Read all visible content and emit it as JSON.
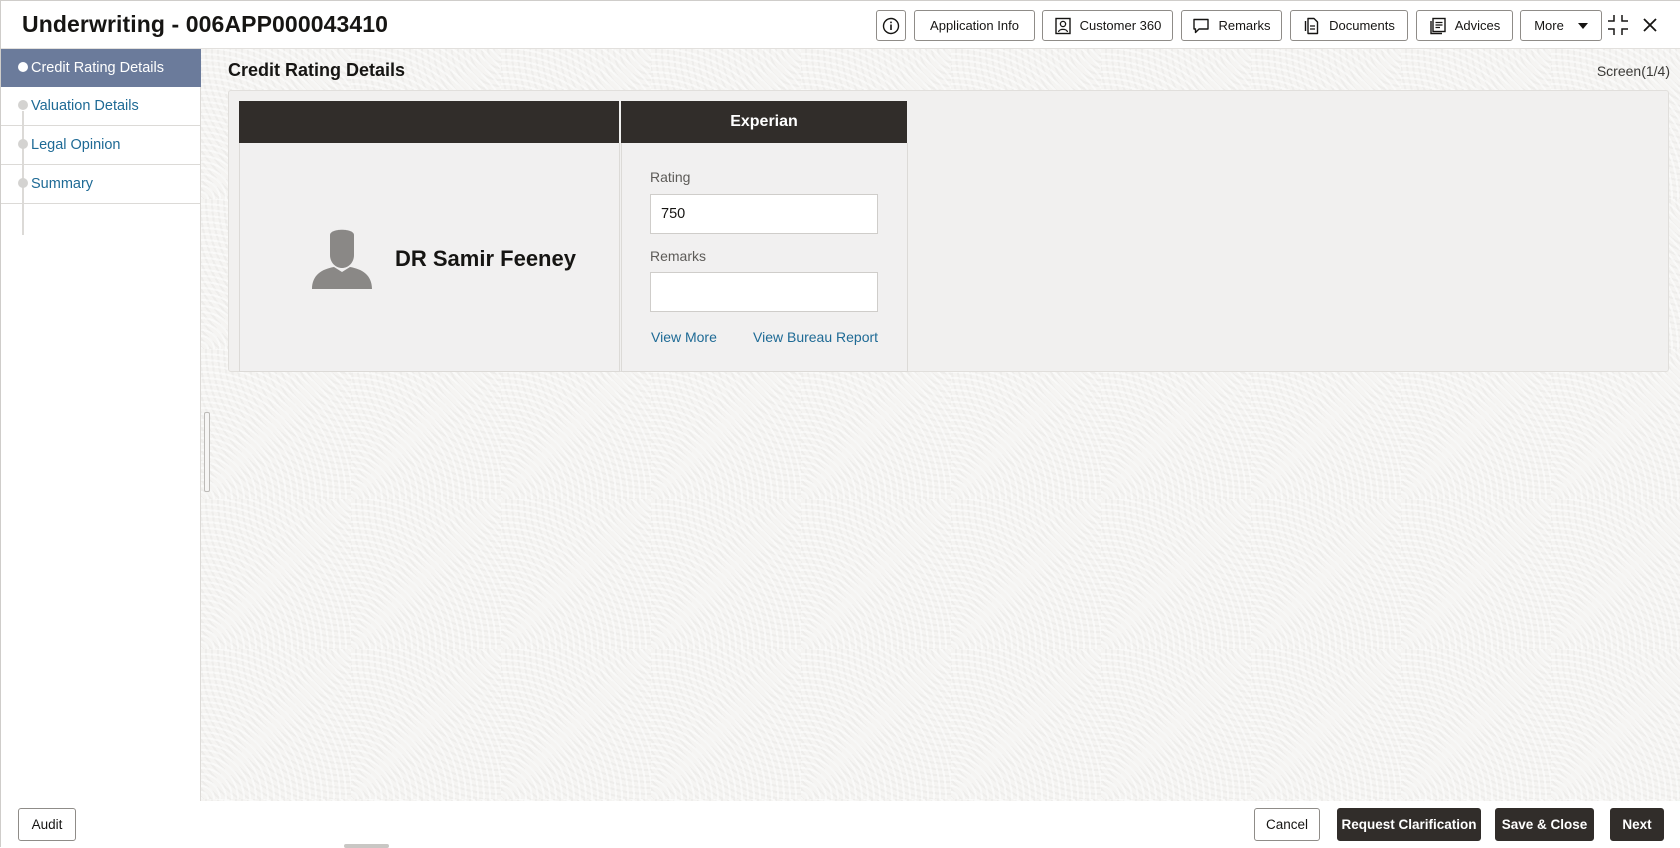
{
  "header": {
    "title": "Underwriting - 006APP000043410",
    "buttons": {
      "application_info": "Application Info",
      "customer_360": "Customer 360",
      "remarks": "Remarks",
      "documents": "Documents",
      "advices": "Advices",
      "more": "More"
    }
  },
  "sidebar": {
    "items": [
      {
        "label": "Credit Rating Details",
        "active": true
      },
      {
        "label": "Valuation Details",
        "active": false
      },
      {
        "label": "Legal Opinion",
        "active": false
      },
      {
        "label": "Summary",
        "active": false
      }
    ]
  },
  "main": {
    "page_title": "Credit Rating Details",
    "screen_indicator": "Screen(1/4)",
    "table": {
      "col1_header": "",
      "col2_header": "Experian",
      "applicant_name": "DR Samir Feeney",
      "rating_label": "Rating",
      "rating_value": "750",
      "remarks_label": "Remarks",
      "remarks_value": "",
      "view_more": "View More",
      "view_bureau_report": "View Bureau Report"
    }
  },
  "footer": {
    "audit": "Audit",
    "cancel": "Cancel",
    "request_clarification": "Request Clarification",
    "save_close": "Save & Close",
    "next": "Next"
  },
  "colors": {
    "accent_link": "#1e6a95",
    "sidebar_active": "#6b7b9b",
    "dark_header": "#312d2a"
  }
}
